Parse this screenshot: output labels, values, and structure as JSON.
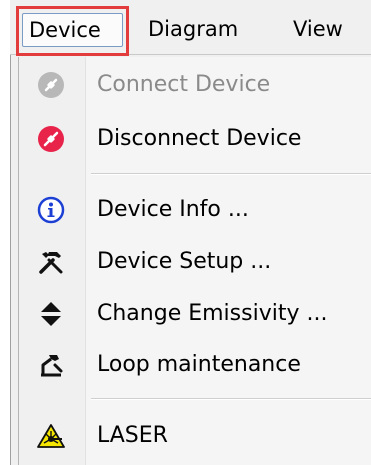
{
  "menubar": {
    "items": [
      {
        "label": "Device"
      },
      {
        "label": "Diagram"
      },
      {
        "label": "View"
      }
    ]
  },
  "dropdown": {
    "items": [
      {
        "label": "Connect Device",
        "icon": "connect-icon",
        "enabled": false
      },
      {
        "label": "Disconnect Device",
        "icon": "disconnect-icon",
        "enabled": true
      },
      {
        "label": "Device Info ...",
        "icon": "info-icon",
        "enabled": true
      },
      {
        "label": "Device Setup ...",
        "icon": "tools-icon",
        "enabled": true
      },
      {
        "label": "Change Emissivity ...",
        "icon": "up-down-arrows-icon",
        "enabled": true
      },
      {
        "label": "Loop maintenance",
        "icon": "loop-maintenance-icon",
        "enabled": true
      },
      {
        "label": "LASER",
        "icon": "laser-warning-icon",
        "enabled": true
      }
    ]
  },
  "colors": {
    "highlight_box": "#e23c3c",
    "disabled_text": "#8a8a8a",
    "disconnect_icon": "#e8244a",
    "info_icon": "#1c3fd4",
    "laser_icon": "#f5e600"
  }
}
